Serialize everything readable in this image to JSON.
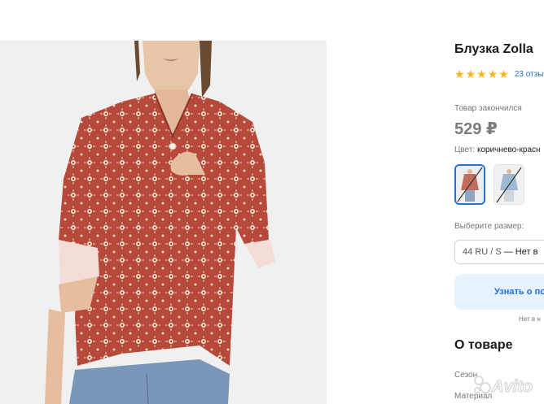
{
  "product": {
    "title": "Блузка Zolla",
    "stars": [
      "★",
      "★",
      "★",
      "★",
      "★"
    ],
    "reviews": "23 отзы",
    "status": "Товар закончился",
    "price": "529 ₽",
    "color_label": "Цвет:",
    "color_value": "коричнево-красн",
    "size_label": "Выберите размер:",
    "size_value": "44 RU / S",
    "size_suffix": "— Нет в",
    "learn_button": "Узнать о по",
    "availability_note": "Нет в н",
    "about_heading": "О товаре",
    "spec_season_label": "Сезон",
    "spec_material_label": "Материал"
  },
  "watermark": "Avito",
  "colors": {
    "accent": "#1f6fe0",
    "star": "#ffb21e",
    "blouse": "#b6493a",
    "button_bg": "#e8f2ff"
  }
}
